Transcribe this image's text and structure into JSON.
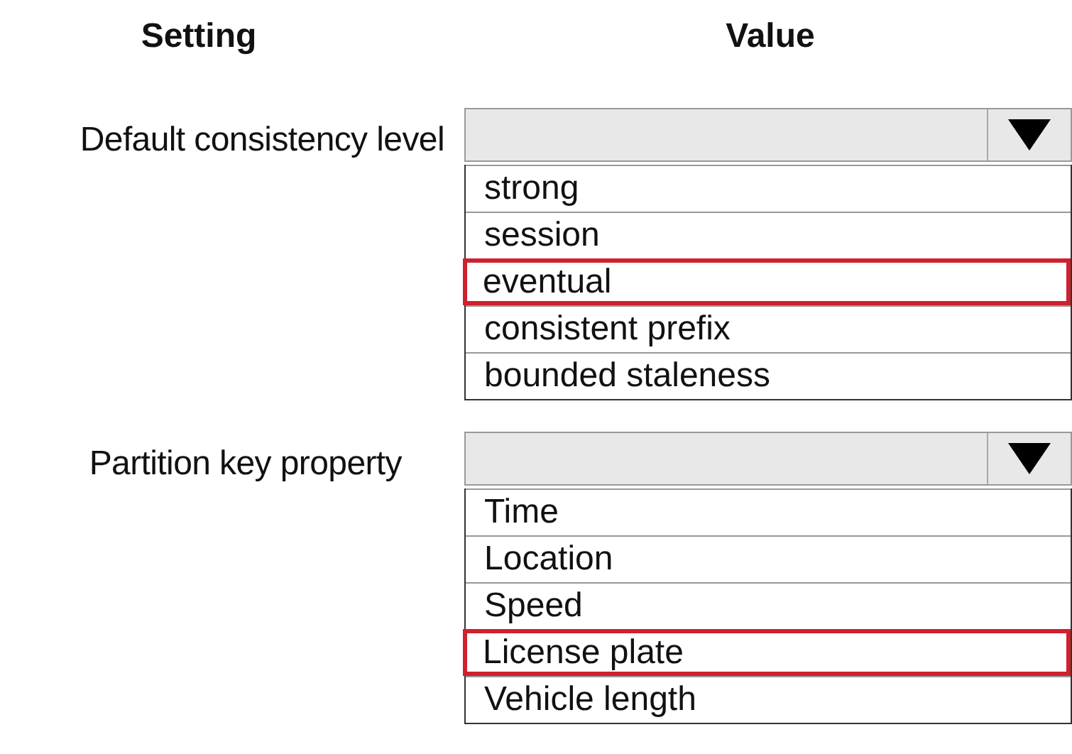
{
  "headers": [
    "Setting",
    "Value"
  ],
  "settings": [
    {
      "label": "Default consistency level",
      "options": [
        {
          "label": "strong",
          "selected": false
        },
        {
          "label": "session",
          "selected": false
        },
        {
          "label": "eventual",
          "selected": true
        },
        {
          "label": "consistent prefix",
          "selected": false
        },
        {
          "label": "bounded staleness",
          "selected": false
        }
      ]
    },
    {
      "label": "Partition key property",
      "options": [
        {
          "label": "Time",
          "selected": false
        },
        {
          "label": "Location",
          "selected": false
        },
        {
          "label": "Speed",
          "selected": false
        },
        {
          "label": "License plate",
          "selected": true
        },
        {
          "label": "Vehicle length",
          "selected": false
        }
      ]
    }
  ]
}
